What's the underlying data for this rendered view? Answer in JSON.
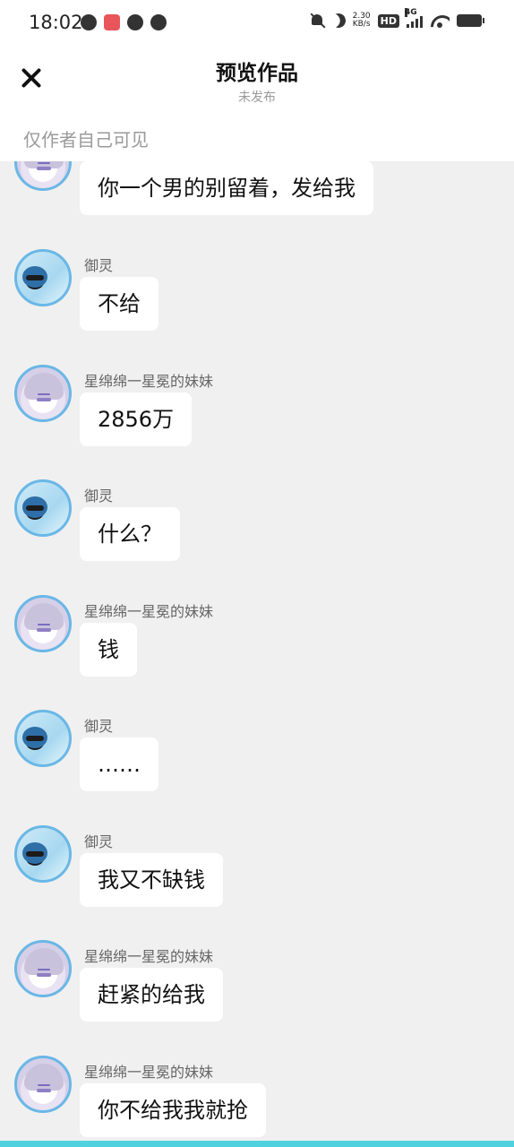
{
  "status_bar": {
    "time": "18:02",
    "net_speed_value": "2.30",
    "net_speed_unit": "KB/s",
    "hd_label": "HD",
    "network_label": "4G"
  },
  "header": {
    "title": "预览作品",
    "subtitle": "未发布",
    "visibility_note": "仅作者自己可见"
  },
  "messages": [
    {
      "sender": "",
      "avatar": "girl",
      "text": "你一个男的别留着，发给我"
    },
    {
      "sender": "御灵",
      "avatar": "boy",
      "text": "不给"
    },
    {
      "sender": "星绵绵一星冕的妹妹",
      "avatar": "girl",
      "text": "2856万"
    },
    {
      "sender": "御灵",
      "avatar": "boy",
      "text": "什么？"
    },
    {
      "sender": "星绵绵一星冕的妹妹",
      "avatar": "girl",
      "text": "钱"
    },
    {
      "sender": "御灵",
      "avatar": "boy",
      "text": "……"
    },
    {
      "sender": "御灵",
      "avatar": "boy",
      "text": "我又不缺钱"
    },
    {
      "sender": "星绵绵一星冕的妹妹",
      "avatar": "girl",
      "text": "赶紧的给我"
    },
    {
      "sender": "星绵绵一星冕的妹妹",
      "avatar": "girl",
      "text": "你不给我我就抢"
    }
  ],
  "colors": {
    "accent_border": "#6ab7e6",
    "bottom_bar": "#4fd1e0",
    "chat_background": "#f0f0f0"
  }
}
